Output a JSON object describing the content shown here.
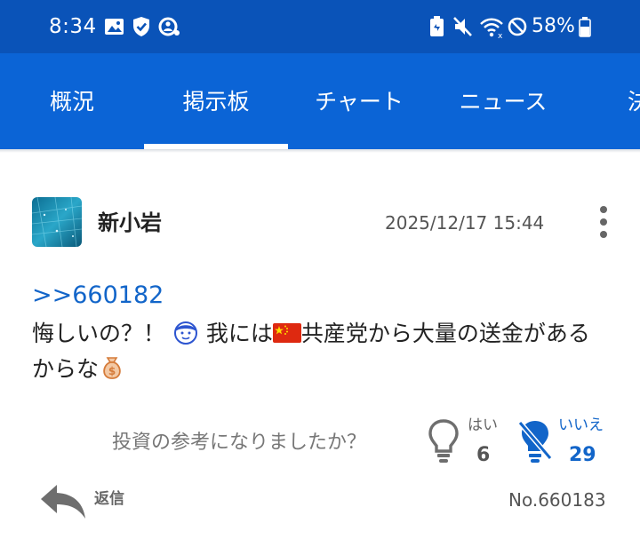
{
  "status_bar": {
    "time": "8:34",
    "battery": "58%",
    "left_icons": [
      "image-icon",
      "shield-check-icon",
      "assistant-icon"
    ],
    "right_icons": [
      "battery-saver-icon",
      "mute-icon",
      "wifi-icon",
      "dnd-icon",
      "battery-icon"
    ],
    "background": "#0a53b8"
  },
  "tabs": {
    "items": [
      {
        "label": "概況"
      },
      {
        "label": "掲示板"
      },
      {
        "label": "チャート"
      },
      {
        "label": "ニュース"
      },
      {
        "label": "決"
      }
    ],
    "active_index": 1,
    "background": "#0b64d6"
  },
  "post": {
    "author": "新小岩",
    "timestamp": "2025/12/17 15:44",
    "reply_to": ">>660182",
    "body": {
      "part1": "悔しいの？！",
      "part2": " 我には",
      "part3": "共産党から大量の送金がある",
      "part4": "からな"
    },
    "emojis": [
      "boy-face-emoji",
      "china-flag-emoji",
      "money-bag-emoji"
    ],
    "link_color": "#1265c9"
  },
  "feedback": {
    "question": "投資の参考になりましたか？",
    "yes_label": "はい",
    "yes_count": "6",
    "no_label": "いいえ",
    "no_count": "29",
    "no_color": "#1265c9"
  },
  "footer": {
    "reply_label": "返信",
    "post_number": "No.660183"
  }
}
